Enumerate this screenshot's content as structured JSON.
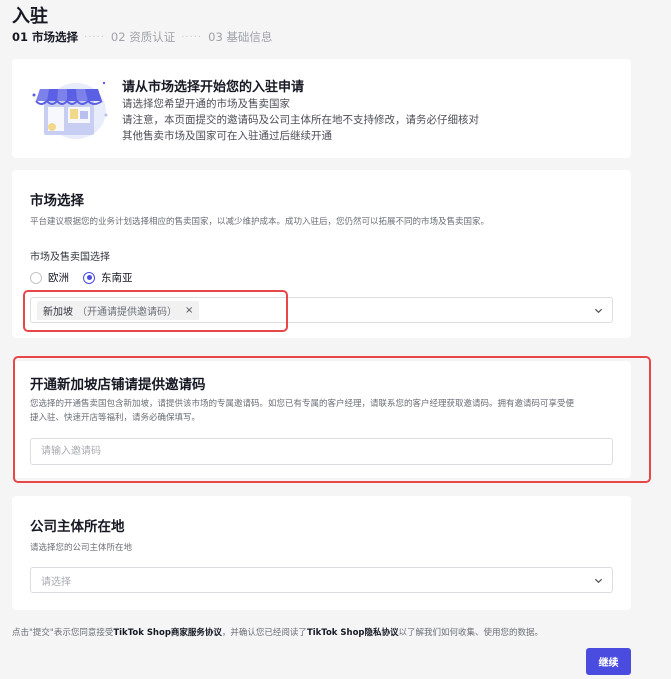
{
  "header": {
    "title": "入驻",
    "steps": [
      {
        "label": "01 市场选择",
        "active": true
      },
      {
        "label": "02 资质认证",
        "active": false
      },
      {
        "label": "03 基础信息",
        "active": false
      }
    ],
    "step_separator": "·····"
  },
  "intro": {
    "illustration_icon": "store-illustration-icon",
    "title": "请从市场选择开始您的入驻申请",
    "lines": [
      "请选择您希望开通的市场及售卖国家",
      "请注意，本页面提交的邀请码及公司主体所在地不支持修改，请务必仔细核对",
      "其他售卖市场及国家可在入驻通过后继续开通"
    ]
  },
  "market": {
    "title": "市场选择",
    "description": "平台建议根据您的业务计划选择相应的售卖国家，以减少维护成本。成功入驻后，您仍然可以拓展不同的市场及售卖国家。",
    "field_label": "市场及售卖国选择",
    "radios": [
      {
        "label": "欧洲",
        "checked": false
      },
      {
        "label": "东南亚",
        "checked": true
      }
    ],
    "selected_tag": {
      "name": "新加坡",
      "note": "（开通请提供邀请码）",
      "remove": "×"
    }
  },
  "invite": {
    "title": "开通新加坡店铺请提供邀请码",
    "description_lines": [
      "您选择的开通售卖国包含新加坡，请提供该市场的专属邀请码。如您已有专属的客户经理，请联系您的客户经理获取邀请码。拥有邀请码可享受便",
      "捷入驻、快速开店等福利，请务必确保填写。"
    ],
    "input_value": "",
    "input_placeholder": "请输入邀请码"
  },
  "company": {
    "title": "公司主体所在地",
    "description": "请选择您的公司主体所在地",
    "select_placeholder": "请选择"
  },
  "footer": {
    "note_prefix": "点击\"提交\"表示您同意接受",
    "link1": "TikTok Shop商家服务协议",
    "note_middle": "，并确认您已经阅读了",
    "link2": "TikTok Shop隐私协议",
    "note_suffix": "以了解我们如何收集、使用您的数据。",
    "continue_label": "继续"
  },
  "colors": {
    "accent": "#4a4ce0",
    "highlight": "#e8474a",
    "background": "#f5f5f6"
  }
}
